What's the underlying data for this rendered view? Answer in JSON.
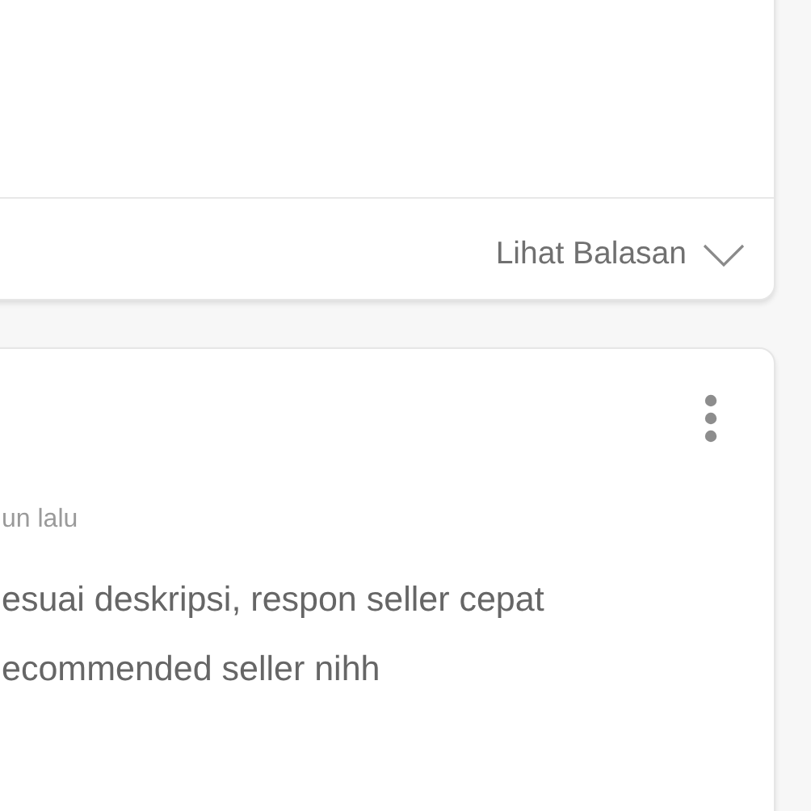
{
  "reviews": [
    {
      "replies_toggle": {
        "label": "Lihat Balasan",
        "expanded": false
      }
    },
    {
      "has_menu": true,
      "time": "un lalu",
      "lines": [
        "esuai deskripsi, respon seller cepat",
        "ecommended seller nihh"
      ]
    }
  ]
}
